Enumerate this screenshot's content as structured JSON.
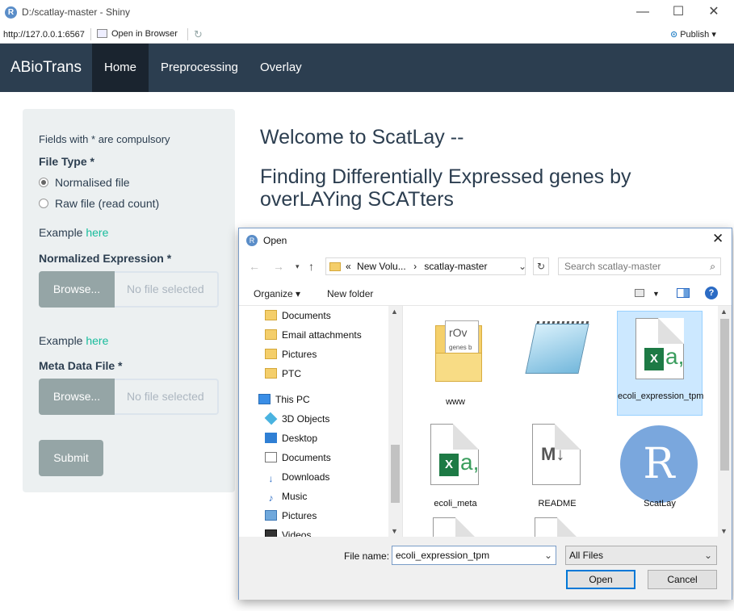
{
  "window": {
    "title": "D:/scatlay-master - Shiny",
    "url": "http://127.0.0.1:6567",
    "open_in_browser": "Open in Browser",
    "publish": "Publish"
  },
  "navbar": {
    "brand": "ABioTrans",
    "tabs": [
      {
        "label": "Home",
        "active": true
      },
      {
        "label": "Preprocessing",
        "active": false
      },
      {
        "label": "Overlay",
        "active": false
      }
    ]
  },
  "sidebar": {
    "note": "Fields with * are compulsory",
    "file_type_label": "File Type *",
    "radio_options": [
      {
        "label": "Normalised file",
        "checked": true
      },
      {
        "label": "Raw file (read count)",
        "checked": false
      }
    ],
    "example1_prefix": "Example ",
    "example1_link": "here",
    "normalized_label": "Normalized Expression *",
    "browse1": "Browse...",
    "file1_placeholder": "No file selected",
    "example2_prefix": "Example ",
    "example2_link": "here",
    "meta_label": "Meta Data File *",
    "browse2": "Browse...",
    "file2_placeholder": "No file selected",
    "submit": "Submit"
  },
  "main": {
    "welcome": "Welcome to ScatLay --",
    "subtitle": "Finding Differentially Expressed genes by overLAYing SCATters"
  },
  "dialog": {
    "title": "Open",
    "breadcrumb": [
      "«",
      "New Volu...",
      "›",
      "scatlay-master"
    ],
    "search_placeholder": "Search scatlay-master",
    "toolbar": {
      "organize": "Organize ▾",
      "new_folder": "New folder",
      "help": "?"
    },
    "nav_items": [
      {
        "label": "Documents",
        "icon": "folder-icon"
      },
      {
        "label": "Email attachments",
        "icon": "folder-icon"
      },
      {
        "label": "Pictures",
        "icon": "folder-icon"
      },
      {
        "label": "PTC",
        "icon": "folder-icon"
      },
      {
        "label": "This PC",
        "icon": "computer-icon"
      },
      {
        "label": "3D Objects",
        "icon": "3d-objects-icon"
      },
      {
        "label": "Desktop",
        "icon": "desktop-icon"
      },
      {
        "label": "Documents",
        "icon": "documents-icon"
      },
      {
        "label": "Downloads",
        "icon": "downloads-icon"
      },
      {
        "label": "Music",
        "icon": "music-icon"
      },
      {
        "label": "Pictures",
        "icon": "pictures-icon"
      },
      {
        "label": "Videos",
        "icon": "videos-icon"
      }
    ],
    "files": [
      {
        "label": "www",
        "icon": "folder-icon",
        "selected": false
      },
      {
        "label": "",
        "icon": "notepad-file-icon",
        "selected": false
      },
      {
        "label": "ecoli_expression_tpm",
        "icon": "excel-csv-icon",
        "selected": true
      },
      {
        "label": "ecoli_meta",
        "icon": "excel-csv-icon",
        "selected": false
      },
      {
        "label": "README",
        "icon": "markdown-file-icon",
        "selected": false
      },
      {
        "label": "ScatLay",
        "icon": "r-project-icon",
        "selected": false
      }
    ],
    "file_name_label": "File name:",
    "file_name_value": "ecoli_expression_tpm",
    "file_type_value": "All Files",
    "open_button": "Open",
    "cancel_button": "Cancel"
  }
}
